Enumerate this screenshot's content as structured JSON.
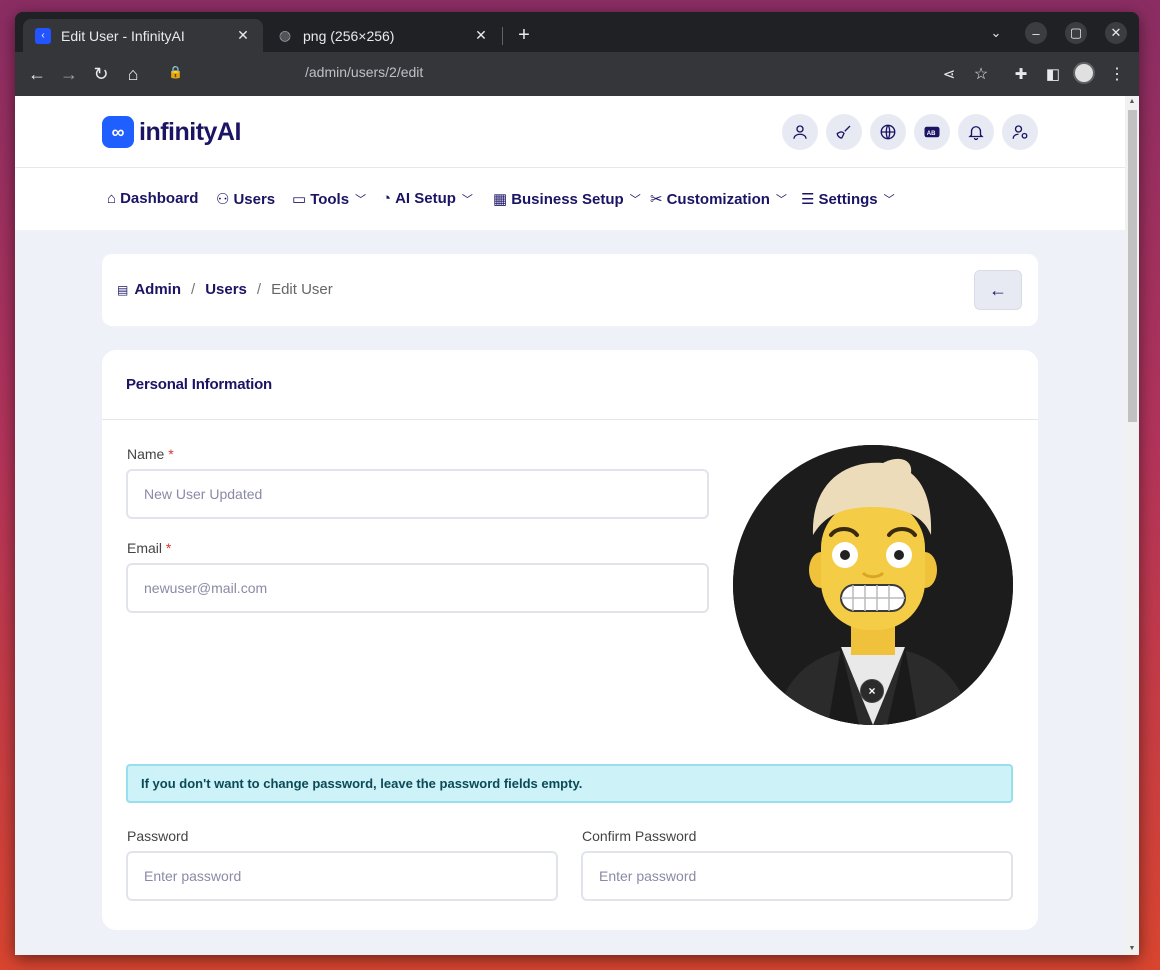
{
  "browser": {
    "tabs": [
      {
        "title": "Edit User - InfinityAI",
        "favicon": "app-icon",
        "active": true
      },
      {
        "title": "png (256×256)",
        "favicon": "globe-icon",
        "active": false
      }
    ],
    "url": "/admin/users/2/edit"
  },
  "header": {
    "logo_mark": "∞",
    "logo_text": "infinityAI",
    "icons": [
      "user-icon",
      "broom-icon",
      "globe-icon",
      "language-icon",
      "bell-icon",
      "user-settings-icon"
    ]
  },
  "nav": [
    {
      "label": "Dashboard",
      "icon": "home-icon",
      "dropdown": false
    },
    {
      "label": "Users",
      "icon": "users-icon",
      "dropdown": false
    },
    {
      "label": "Tools",
      "icon": "briefcase-icon",
      "dropdown": true
    },
    {
      "label": "AI Setup",
      "icon": "gauge-icon",
      "dropdown": true
    },
    {
      "label": "Business Setup",
      "icon": "building-icon",
      "dropdown": true
    },
    {
      "label": "Customization",
      "icon": "tools-icon",
      "dropdown": true
    },
    {
      "label": "Settings",
      "icon": "sliders-icon",
      "dropdown": true
    }
  ],
  "breadcrumb": {
    "items": [
      "Admin",
      "Users"
    ],
    "current": "Edit User",
    "separator": "/",
    "back_label": "←"
  },
  "form": {
    "section_title": "Personal Information",
    "name_label": "Name",
    "name_value": "New User Updated",
    "email_label": "Email",
    "email_value": "newuser@mail.com",
    "required_mark": "*",
    "alert": "If you don't want to change password, leave the password fields empty.",
    "password_label": "Password",
    "password_placeholder": "Enter password",
    "confirm_label": "Confirm Password",
    "confirm_placeholder": "Enter password",
    "avatar_remove": "×"
  },
  "colors": {
    "brand": "#1f5fff",
    "nav_text": "#1b1464",
    "alert_bg": "#cdf2f8",
    "page_bg": "#eef1f7"
  }
}
